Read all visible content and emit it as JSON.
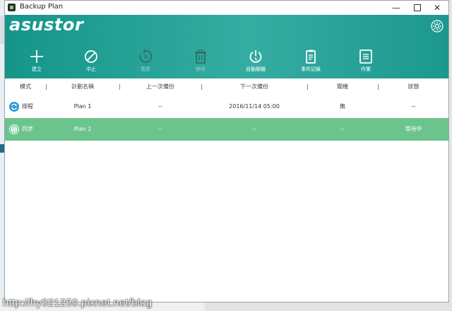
{
  "window": {
    "title": "Backup Plan"
  },
  "brand": {
    "logo": "asustor"
  },
  "toolbar": [
    {
      "key": "create",
      "label": "建立",
      "icon": "plus-icon",
      "disabled": false
    },
    {
      "key": "stop",
      "label": "中止",
      "icon": "stop-icon",
      "disabled": false
    },
    {
      "key": "restore",
      "label": "復原",
      "icon": "restore-icon",
      "disabled": true
    },
    {
      "key": "remove",
      "label": "移除",
      "icon": "trash-icon",
      "disabled": true
    },
    {
      "key": "auto_shutdown",
      "label": "自動關機",
      "icon": "power-icon",
      "disabled": false
    },
    {
      "key": "event_log",
      "label": "事件記錄",
      "icon": "log-icon",
      "disabled": false
    },
    {
      "key": "jobs",
      "label": "作業",
      "icon": "jobs-icon",
      "disabled": false
    }
  ],
  "table": {
    "columns": [
      "模式",
      "計劃名稱",
      "上一次備份",
      "下一次備份",
      "關機",
      "狀態"
    ],
    "rows": [
      {
        "mode": "排程",
        "name": "Plan 1",
        "last": "--",
        "next": "2016/11/14 05:00",
        "shutdown": "無",
        "status": "--",
        "selected": false
      },
      {
        "mode": "同步",
        "name": "Plan 2",
        "last": "--",
        "next": "--",
        "shutdown": "--",
        "status": "等待中",
        "selected": true
      }
    ]
  },
  "watermark": "http://hy321250.pixnet.net/blog",
  "colors": {
    "header": "#23a096",
    "selected_row": "#6bc48c",
    "icon_blue": "#2b9ad8"
  }
}
